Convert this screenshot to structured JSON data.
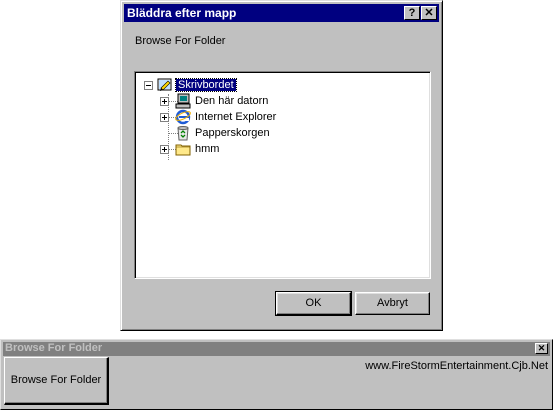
{
  "dialog": {
    "title": "Bläddra efter mapp",
    "help_button": "?",
    "close_button": "✕",
    "prompt": "Browse For Folder",
    "tree": {
      "root": {
        "label": "Skrivbordet",
        "icon": "desktop-icon",
        "expanded": true,
        "selected": true
      },
      "children": [
        {
          "label": "Den här datorn",
          "icon": "computer-icon",
          "expandable": true
        },
        {
          "label": "Internet Explorer",
          "icon": "internet-explorer-icon",
          "expandable": true
        },
        {
          "label": "Papperskorgen",
          "icon": "recycle-bin-icon",
          "expandable": false
        },
        {
          "label": "hmm",
          "icon": "folder-icon",
          "expandable": true
        }
      ]
    },
    "ok_label": "OK",
    "cancel_label": "Avbryt"
  },
  "app": {
    "title": "Browse For Folder",
    "close_button": "✕",
    "button_label": "Browse For Folder",
    "url": "www.FireStormEntertainment.Cjb.Net"
  }
}
